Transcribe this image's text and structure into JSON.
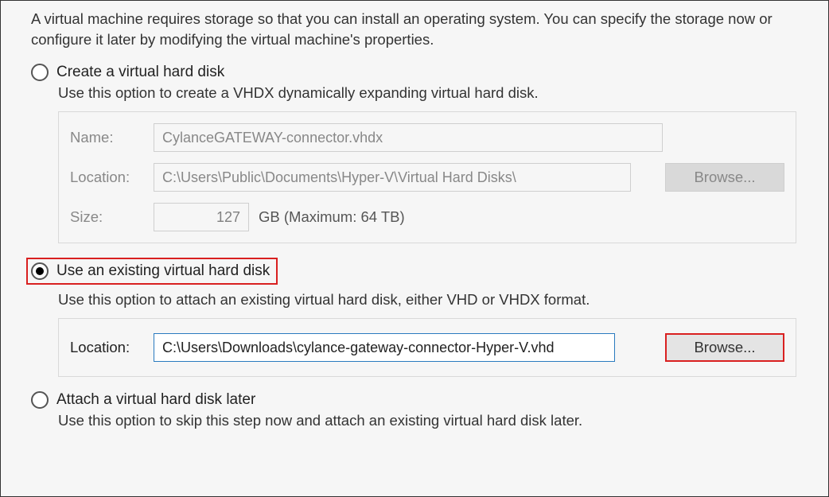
{
  "intro": "A virtual machine requires storage so that you can install an operating system. You can specify the storage now or configure it later by modifying the virtual machine's properties.",
  "options": {
    "create": {
      "label": "Create a virtual hard disk",
      "desc": "Use this option to create a VHDX dynamically expanding virtual hard disk.",
      "name_label": "Name:",
      "name_value": "CylanceGATEWAY-connector.vhdx",
      "location_label": "Location:",
      "location_value": "C:\\Users\\Public\\Documents\\Hyper-V\\Virtual Hard Disks\\",
      "browse_label": "Browse...",
      "size_label": "Size:",
      "size_value": "127",
      "size_suffix": "GB (Maximum: 64 TB)"
    },
    "existing": {
      "label": "Use an existing virtual hard disk",
      "desc": "Use this option to attach an existing virtual hard disk, either VHD or VHDX format.",
      "location_label": "Location:",
      "location_value": "C:\\Users\\Downloads\\cylance-gateway-connector-Hyper-V.vhd",
      "browse_label": "Browse..."
    },
    "later": {
      "label": "Attach a virtual hard disk later",
      "desc": "Use this option to skip this step now and attach an existing virtual hard disk later."
    }
  }
}
